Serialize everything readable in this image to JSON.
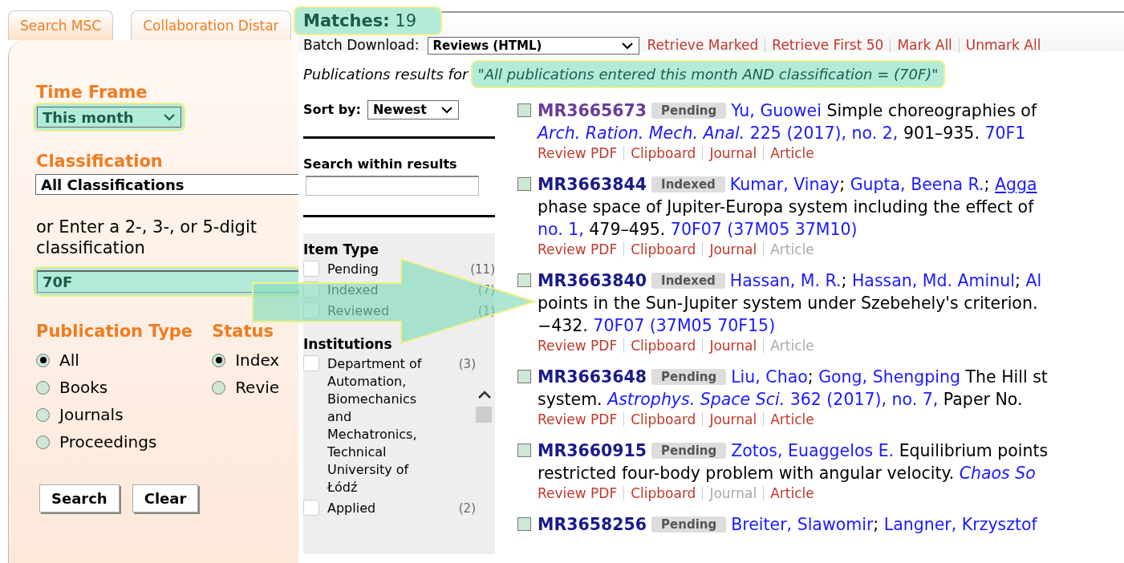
{
  "tabs": [
    {
      "label": "Search MSC",
      "selected": true
    },
    {
      "label": "Collaboration Distar",
      "selected": false
    }
  ],
  "search_form": {
    "time_frame": {
      "label": "Time Frame",
      "value": "This month",
      "highlighted": true
    },
    "classification": {
      "label": "Classification",
      "value": "All Classifications",
      "highlighted": false
    },
    "code_prompt": "or Enter a 2-, 3-, or 5-digit classification",
    "code_field": {
      "value": "70F",
      "highlighted": true
    },
    "publication_type": {
      "label": "Publication Type",
      "options": [
        {
          "label": "All",
          "selected": true
        },
        {
          "label": "Books",
          "selected": false
        },
        {
          "label": "Journals",
          "selected": false
        },
        {
          "label": "Proceedings",
          "selected": false
        }
      ]
    },
    "status": {
      "label": "Status",
      "options": [
        {
          "label": "Index",
          "selected": true
        },
        {
          "label": "Revie",
          "selected": false
        }
      ]
    },
    "buttons": [
      "Search",
      "Clear"
    ]
  },
  "matches": {
    "label": "Matches:",
    "count": "19",
    "highlighted": true
  },
  "batch": {
    "label": "Batch Download:",
    "value": "Reviews (HTML)",
    "links": [
      "Retrieve Marked",
      "Retrieve First 50",
      "Mark All",
      "Unmark All"
    ]
  },
  "query": {
    "prefix": "Publications results for",
    "text": "\"All publications entered this month AND classification = (70F)\"",
    "highlighted": true
  },
  "sort": {
    "label": "Sort by:",
    "value": "Newest"
  },
  "search_within": {
    "label": "Search within results"
  },
  "item_type": {
    "title": "Item Type",
    "items": [
      {
        "label": "Pending",
        "count": "(11)",
        "checked": false
      },
      {
        "label": "Indexed",
        "count": "(7)",
        "checked": false
      },
      {
        "label": "Reviewed",
        "count": "(1)",
        "checked": false
      }
    ]
  },
  "institutions": {
    "title": "Institutions",
    "items": [
      {
        "label": "Department of Automation, Biomechanics and Mechatronics, Technical University of Łódź",
        "count": "(3)",
        "checked": false
      },
      {
        "label": "Applied",
        "count": "(2)",
        "checked": false
      }
    ]
  },
  "results": [
    {
      "id": "MR3665673",
      "marked": false,
      "visited": true,
      "status": "Pending",
      "lines": [
        [
          {
            "kind": "author",
            "text": "Yu, Guowei"
          },
          {
            "kind": "text",
            "text": " Simple choreographies of"
          }
        ],
        [
          {
            "kind": "journal",
            "text": "Arch. Ration. Mech. Anal."
          },
          {
            "kind": "link",
            "text": " 225 (2017), no. 2,"
          },
          {
            "kind": "text",
            "text": " 901–935."
          },
          {
            "kind": "link",
            "text": " 70F1"
          }
        ]
      ],
      "actions": [
        {
          "label": "Review PDF",
          "disabled": false
        },
        {
          "label": "Clipboard",
          "disabled": false
        },
        {
          "label": "Journal",
          "disabled": false
        },
        {
          "label": "Article",
          "disabled": false
        }
      ]
    },
    {
      "id": "MR3663844",
      "marked": false,
      "visited": false,
      "status": "Indexed",
      "lines": [
        [
          {
            "kind": "author",
            "text": "Kumar, Vinay"
          },
          {
            "kind": "text",
            "text": "; "
          },
          {
            "kind": "author",
            "text": "Gupta, Beena R."
          },
          {
            "kind": "text",
            "text": "; "
          },
          {
            "kind": "hovered_author",
            "text": "Agga"
          }
        ],
        [
          {
            "kind": "text",
            "text": "phase space of Jupiter-Europa system including the effect of"
          }
        ],
        [
          {
            "kind": "link",
            "text": "no. 1,"
          },
          {
            "kind": "text",
            "text": " 479–495."
          },
          {
            "kind": "link",
            "text": " 70F07 (37M05 37M10)"
          }
        ]
      ],
      "actions": [
        {
          "label": "Review PDF",
          "disabled": false
        },
        {
          "label": "Clipboard",
          "disabled": false
        },
        {
          "label": "Journal",
          "disabled": false
        },
        {
          "label": "Article",
          "disabled": true
        }
      ]
    },
    {
      "id": "MR3663840",
      "marked": false,
      "visited": false,
      "status": "Indexed",
      "lines": [
        [
          {
            "kind": "author",
            "text": "Hassan, M. R."
          },
          {
            "kind": "text",
            "text": "; "
          },
          {
            "kind": "author",
            "text": "Hassan, Md. Aminul"
          },
          {
            "kind": "text",
            "text": "; "
          },
          {
            "kind": "author",
            "text": "Al"
          }
        ],
        [
          {
            "kind": "text",
            "text": "points in the Sun-Jupiter system under Szebehely's criterion."
          }
        ],
        [
          {
            "kind": "text",
            "text": "−432."
          },
          {
            "kind": "link",
            "text": " 70F07 (37M05 70F15)"
          }
        ]
      ],
      "actions": [
        {
          "label": "Review PDF",
          "disabled": false
        },
        {
          "label": "Clipboard",
          "disabled": false
        },
        {
          "label": "Journal",
          "disabled": false
        },
        {
          "label": "Article",
          "disabled": true
        }
      ]
    },
    {
      "id": "MR3663648",
      "marked": false,
      "visited": false,
      "status": "Pending",
      "lines": [
        [
          {
            "kind": "author",
            "text": "Liu, Chao"
          },
          {
            "kind": "text",
            "text": "; "
          },
          {
            "kind": "author",
            "text": "Gong, Shengping"
          },
          {
            "kind": "text",
            "text": " The Hill st"
          }
        ],
        [
          {
            "kind": "text",
            "text": "system. "
          },
          {
            "kind": "journal",
            "text": "Astrophys. Space Sci."
          },
          {
            "kind": "link",
            "text": " 362 (2017), no. 7,"
          },
          {
            "kind": "text",
            "text": " Paper No."
          }
        ]
      ],
      "actions": [
        {
          "label": "Review PDF",
          "disabled": false
        },
        {
          "label": "Clipboard",
          "disabled": false
        },
        {
          "label": "Journal",
          "disabled": false
        },
        {
          "label": "Article",
          "disabled": false
        }
      ]
    },
    {
      "id": "MR3660915",
      "marked": false,
      "visited": false,
      "status": "Pending",
      "lines": [
        [
          {
            "kind": "author",
            "text": "Zotos, Euaggelos E."
          },
          {
            "kind": "text",
            "text": " Equilibrium points"
          }
        ],
        [
          {
            "kind": "text",
            "text": "restricted four-body problem with angular velocity. "
          },
          {
            "kind": "journal",
            "text": "Chaos So"
          }
        ]
      ],
      "actions": [
        {
          "label": "Review PDF",
          "disabled": false
        },
        {
          "label": "Clipboard",
          "disabled": false
        },
        {
          "label": "Journal",
          "disabled": true
        },
        {
          "label": "Article",
          "disabled": false
        }
      ]
    },
    {
      "id": "MR3658256",
      "marked": false,
      "visited": false,
      "status": "Pending",
      "lines": [
        [
          {
            "kind": "author",
            "text": "Breiter, Slawomir"
          },
          {
            "kind": "text",
            "text": "; "
          },
          {
            "kind": "author",
            "text": "Langner, Krzysztof"
          }
        ]
      ]
    }
  ]
}
